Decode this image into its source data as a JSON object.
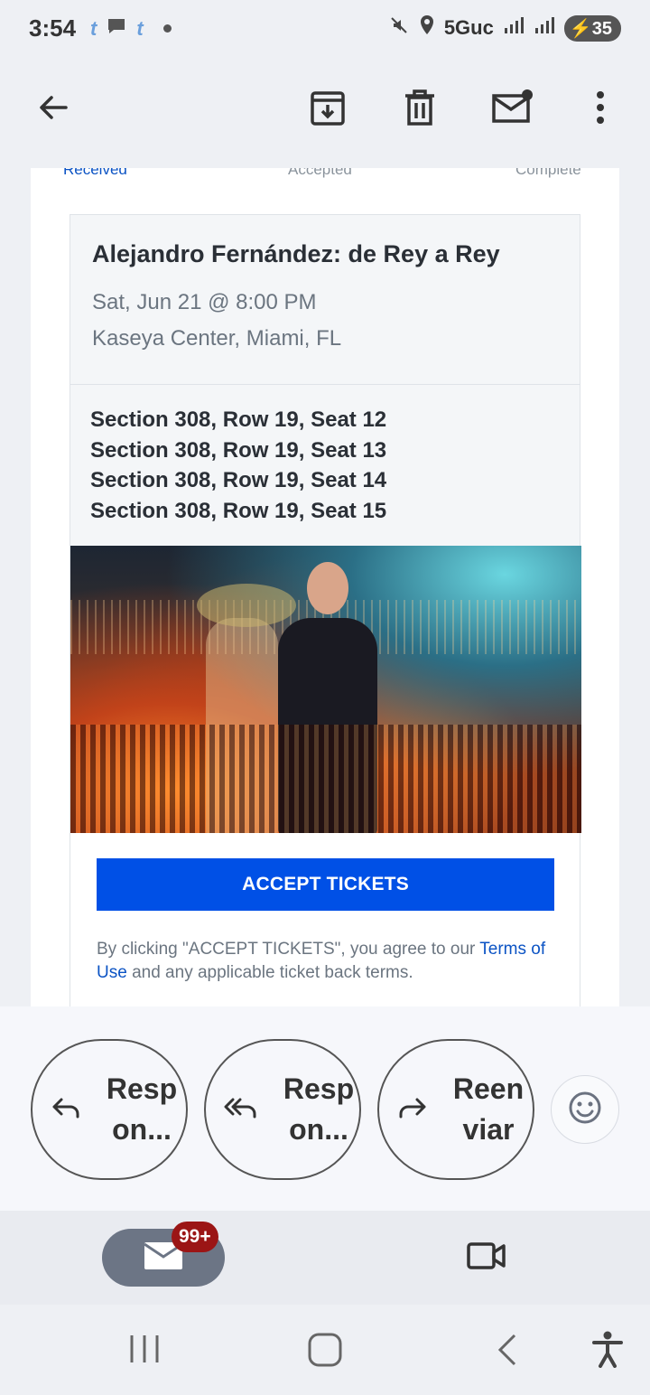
{
  "status_bar": {
    "time": "3:54",
    "network": "5Guc",
    "battery": "35",
    "left_icons": [
      "tumblr-icon",
      "chat-icon",
      "tumblr-icon"
    ],
    "right_icons": [
      "mute-icon",
      "location-icon",
      "signal-icon",
      "signal-icon"
    ]
  },
  "toolbar": {
    "icons": [
      "back-arrow-icon",
      "archive-icon",
      "delete-icon",
      "mark-unread-icon",
      "more-icon"
    ]
  },
  "email": {
    "steps": [
      "Received",
      "Accepted",
      "Complete"
    ],
    "event": {
      "title": "Alejandro Fernández: de Rey a Rey",
      "date": "Sat, Jun 21 @ 8:00 PM",
      "venue": "Kaseya Center, Miami, FL"
    },
    "seats": [
      "Section 308, Row 19, Seat 12",
      "Section 308, Row 19, Seat 13",
      "Section 308, Row 19, Seat 14",
      "Section 308, Row 19, Seat 15"
    ],
    "accept_button": "ACCEPT TICKETS",
    "terms": {
      "prefix": "By clicking \"ACCEPT TICKETS\", you agree to our ",
      "link": "Terms of Use",
      "suffix": " and any applicable ticket back terms."
    },
    "colors": {
      "accent": "#0050e6",
      "link": "#0b53c4"
    }
  },
  "replies": {
    "reply": "Resp on...",
    "reply_all": "Resp on...",
    "forward": "Reen viar"
  },
  "bottom_nav": {
    "mail_badge": "99+"
  }
}
